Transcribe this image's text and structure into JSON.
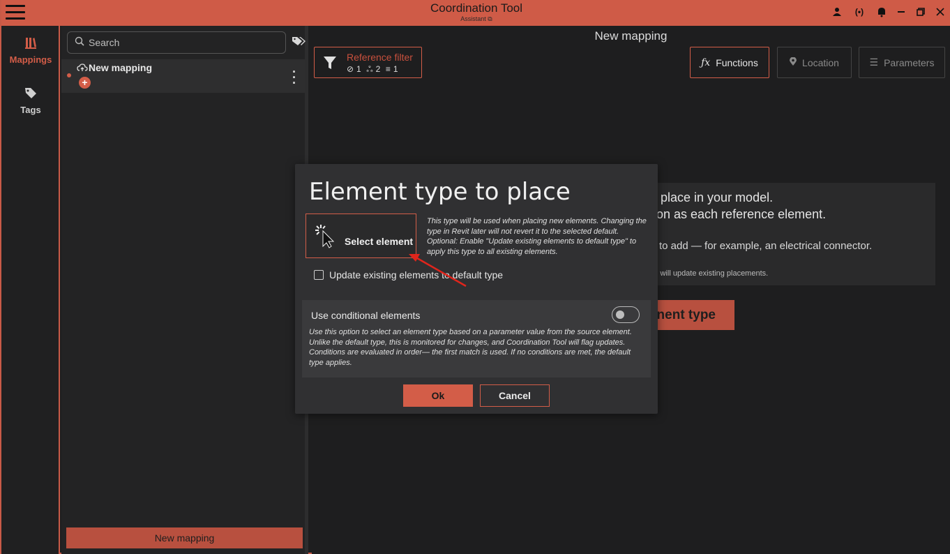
{
  "window": {
    "title": "Coordination Tool",
    "subtitle": "Assistant",
    "accent": "#cf5b47"
  },
  "titlebar_icons": [
    "menu-icon",
    "user-icon",
    "broadcast-icon",
    "bell-icon",
    "minimize-icon",
    "restore-icon",
    "close-icon"
  ],
  "rail": {
    "items": [
      {
        "label": "Mappings",
        "icon": "library-icon",
        "active": true
      },
      {
        "label": "Tags",
        "icon": "tag-icon",
        "active": false
      }
    ]
  },
  "mapping_panel": {
    "search_placeholder": "Search",
    "items": [
      {
        "name": "New mapping",
        "icon": "cloud-upload-icon",
        "unsaved": true
      }
    ],
    "new_button": "New mapping"
  },
  "main": {
    "title": "New mapping",
    "reference_filter": {
      "label": "Reference filter",
      "link_count": "1",
      "hierarchy_count": "2",
      "filter_count": "1"
    },
    "tabs": [
      {
        "label": "Functions",
        "icon": "fx-icon",
        "active": true
      },
      {
        "label": "Location",
        "icon": "pin-icon",
        "active": false
      },
      {
        "label": "Parameters",
        "icon": "list-icon",
        "active": false
      }
    ],
    "background_text": {
      "line1": "place in your model.",
      "line2": "on as each reference element.",
      "line3": "to add — for example, an electrical connector.",
      "line4": "l will update existing placements.",
      "button": "nent type"
    }
  },
  "dialog": {
    "title": "Element type to place",
    "select_button": "Select element",
    "help_text": "This type will be used when placing new elements. Changing the type in Revit later will not revert it to the selected default. Optional: Enable \"Update existing elements to default type\" to apply this type to all existing elements.",
    "update_checkbox": {
      "label": "Update existing elements to default type",
      "checked": false
    },
    "conditional": {
      "label": "Use conditional elements",
      "enabled": false,
      "help": "Use this option to select an element type based on a parameter value from the source element. Unlike the default type, this is monitored for changes, and Coordination Tool will flag updates. Conditions are evaluated in order— the first match is used. If no conditions are met, the default type applies."
    },
    "ok": "Ok",
    "cancel": "Cancel"
  }
}
